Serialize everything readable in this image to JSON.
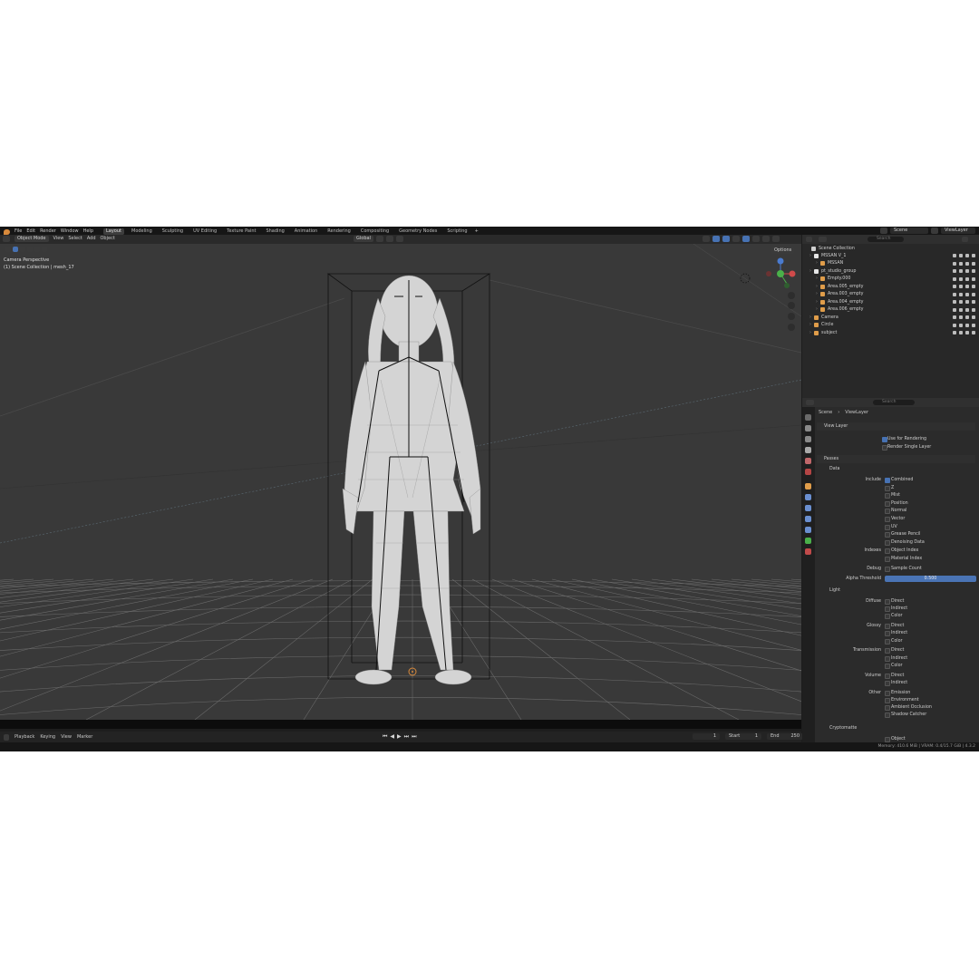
{
  "menubar": {
    "menus": [
      "File",
      "Edit",
      "Render",
      "Window",
      "Help"
    ],
    "workspaces": [
      {
        "label": "Layout",
        "active": true
      },
      {
        "label": "Modeling",
        "active": false
      },
      {
        "label": "Sculpting",
        "active": false
      },
      {
        "label": "UV Editing",
        "active": false
      },
      {
        "label": "Texture Paint",
        "active": false
      },
      {
        "label": "Shading",
        "active": false
      },
      {
        "label": "Animation",
        "active": false
      },
      {
        "label": "Rendering",
        "active": false
      },
      {
        "label": "Compositing",
        "active": false
      },
      {
        "label": "Geometry Nodes",
        "active": false
      },
      {
        "label": "Scripting",
        "active": false
      }
    ],
    "add_workspace": "+",
    "scene": "Scene",
    "view_layer": "ViewLayer"
  },
  "viewport_header": {
    "mode": "Object Mode",
    "menus": [
      "View",
      "Select",
      "Add",
      "Object"
    ],
    "transform_orientation": "Global",
    "options": "Options"
  },
  "viewport": {
    "camera_label": "Camera Perspective",
    "collection_label": "(1) Scene Collection | mesh_17"
  },
  "timeline": {
    "menus": [
      "Playback",
      "Keying",
      "View",
      "Marker"
    ],
    "current_frame": "1",
    "start_label": "Start",
    "start": "1",
    "end_label": "End",
    "end": "250"
  },
  "statusbar": {
    "memory": "Memory: 410.6 MiB | VRAM: 0.4/15.7 GiB | 4.3.2"
  },
  "outliner": {
    "search_placeholder": "Search",
    "root": "Scene Collection",
    "rows": [
      {
        "name": "MSSAN V_1",
        "depth": 1,
        "icon_color": "#e6e6e6"
      },
      {
        "name": "MSSAN",
        "depth": 2,
        "icon_color": "#e09d4a"
      },
      {
        "name": "pt_studio_group",
        "depth": 1,
        "icon_color": "#e6e6e6"
      },
      {
        "name": "Empty.000",
        "depth": 2,
        "icon_color": "#e09d4a"
      },
      {
        "name": "Area.005_empty",
        "depth": 2,
        "icon_color": "#e09d4a"
      },
      {
        "name": "Area.003_empty",
        "depth": 2,
        "icon_color": "#e09d4a"
      },
      {
        "name": "Area.004_empty",
        "depth": 2,
        "icon_color": "#e09d4a"
      },
      {
        "name": "Area.006_empty",
        "depth": 2,
        "icon_color": "#e09d4a"
      },
      {
        "name": "Camera",
        "depth": 1,
        "icon_color": "#e09d4a"
      },
      {
        "name": "Circle",
        "depth": 1,
        "icon_color": "#e09d4a"
      },
      {
        "name": "subject",
        "depth": 1,
        "icon_color": "#e09d4a"
      }
    ]
  },
  "properties": {
    "search_placeholder": "Search",
    "breadcrumb": [
      "Scene",
      "ViewLayer"
    ],
    "view_layer_section": "View Layer",
    "use_for_rendering": "Use for Rendering",
    "render_single_layer": "Render Single Layer",
    "passes_section": "Passes",
    "data_section": "Data",
    "include_label": "Include",
    "data_passes": [
      {
        "label": "Combined",
        "checked": true
      },
      {
        "label": "Z",
        "checked": false
      },
      {
        "label": "Mist",
        "checked": false
      },
      {
        "label": "Position",
        "checked": false
      },
      {
        "label": "Normal",
        "checked": false
      },
      {
        "label": "Vector",
        "checked": false
      },
      {
        "label": "UV",
        "checked": false
      },
      {
        "label": "Grease Pencil",
        "checked": false
      },
      {
        "label": "Denoising Data",
        "checked": false
      }
    ],
    "indexes_label": "Indexes",
    "indexes": [
      "Object Index",
      "Material Index"
    ],
    "debug_label": "Debug",
    "debug": [
      "Sample Count"
    ],
    "alpha_threshold_label": "Alpha Threshold",
    "alpha_threshold": "0.500",
    "light_section": "Light",
    "light_groups": [
      {
        "label": "Diffuse",
        "items": [
          "Direct",
          "Indirect",
          "Color"
        ]
      },
      {
        "label": "Glossy",
        "items": [
          "Direct",
          "Indirect",
          "Color"
        ]
      },
      {
        "label": "Transmission",
        "items": [
          "Direct",
          "Indirect",
          "Color"
        ]
      },
      {
        "label": "Volume",
        "items": [
          "Direct",
          "Indirect"
        ]
      },
      {
        "label": "Other",
        "items": [
          "Emission",
          "Environment",
          "Ambient Occlusion",
          "Shadow Catcher"
        ]
      }
    ],
    "cryptomatte_section": "Cryptomatte",
    "cryptomatte_first": "Object"
  },
  "colors": {
    "accent": "#4772b3",
    "viewport_bg": "#393939",
    "panel_bg": "#2b2b2b",
    "object_orange": "#e09d4a"
  }
}
